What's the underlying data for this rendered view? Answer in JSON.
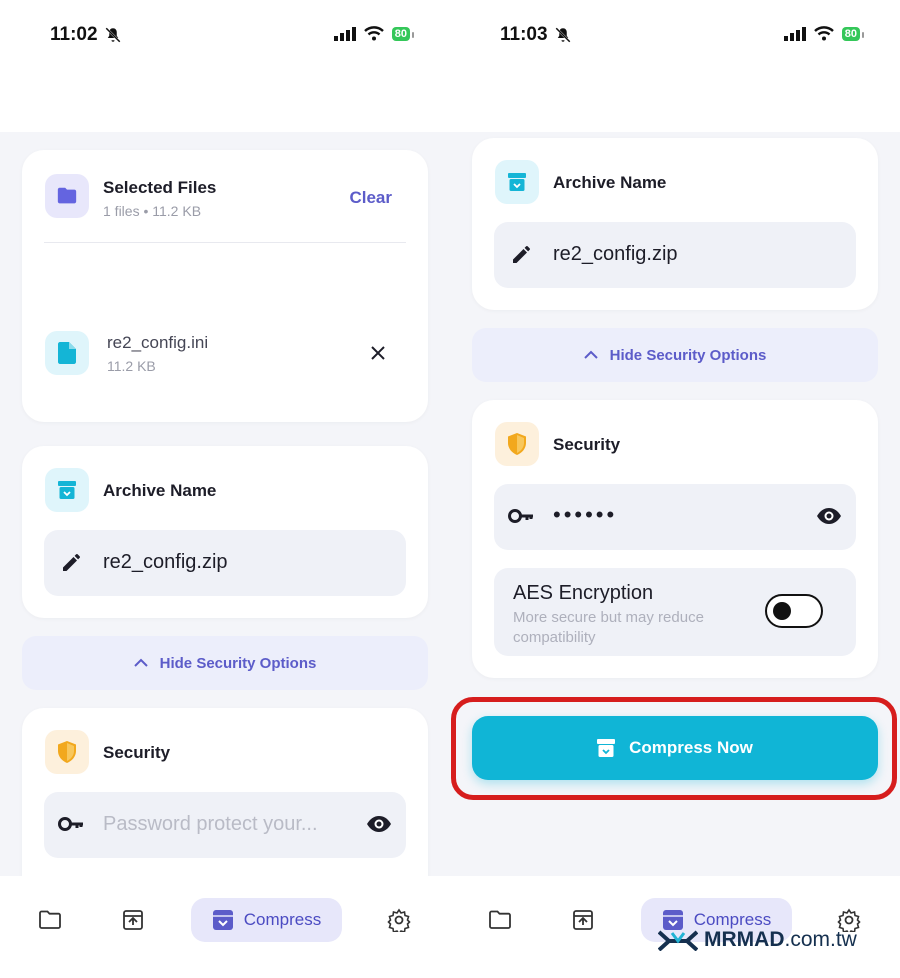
{
  "status": {
    "left_time": "11:02",
    "right_time": "11:03",
    "battery": "80"
  },
  "files_card": {
    "title": "Selected Files",
    "subtitle": "1 files • 11.2 KB",
    "clear": "Clear",
    "file": {
      "name": "re2_config.ini",
      "size": "11.2 KB"
    }
  },
  "archive": {
    "title": "Archive Name",
    "value": "re2_config.zip"
  },
  "security_toggle": "Hide Security Options",
  "security": {
    "title": "Security",
    "password_placeholder": "Password protect your...",
    "password_dots": "••••••",
    "aes_title": "AES Encryption",
    "aes_desc": "More secure but may reduce compatibility"
  },
  "compress_button": "Compress Now",
  "tabs": {
    "active": "Compress"
  },
  "watermark": {
    "brand": "MRMAD",
    "suffix": ".com.tw"
  },
  "colors": {
    "accent": "#10b5d6",
    "primary": "#5c5cc9",
    "highlight": "#d61d1d"
  }
}
